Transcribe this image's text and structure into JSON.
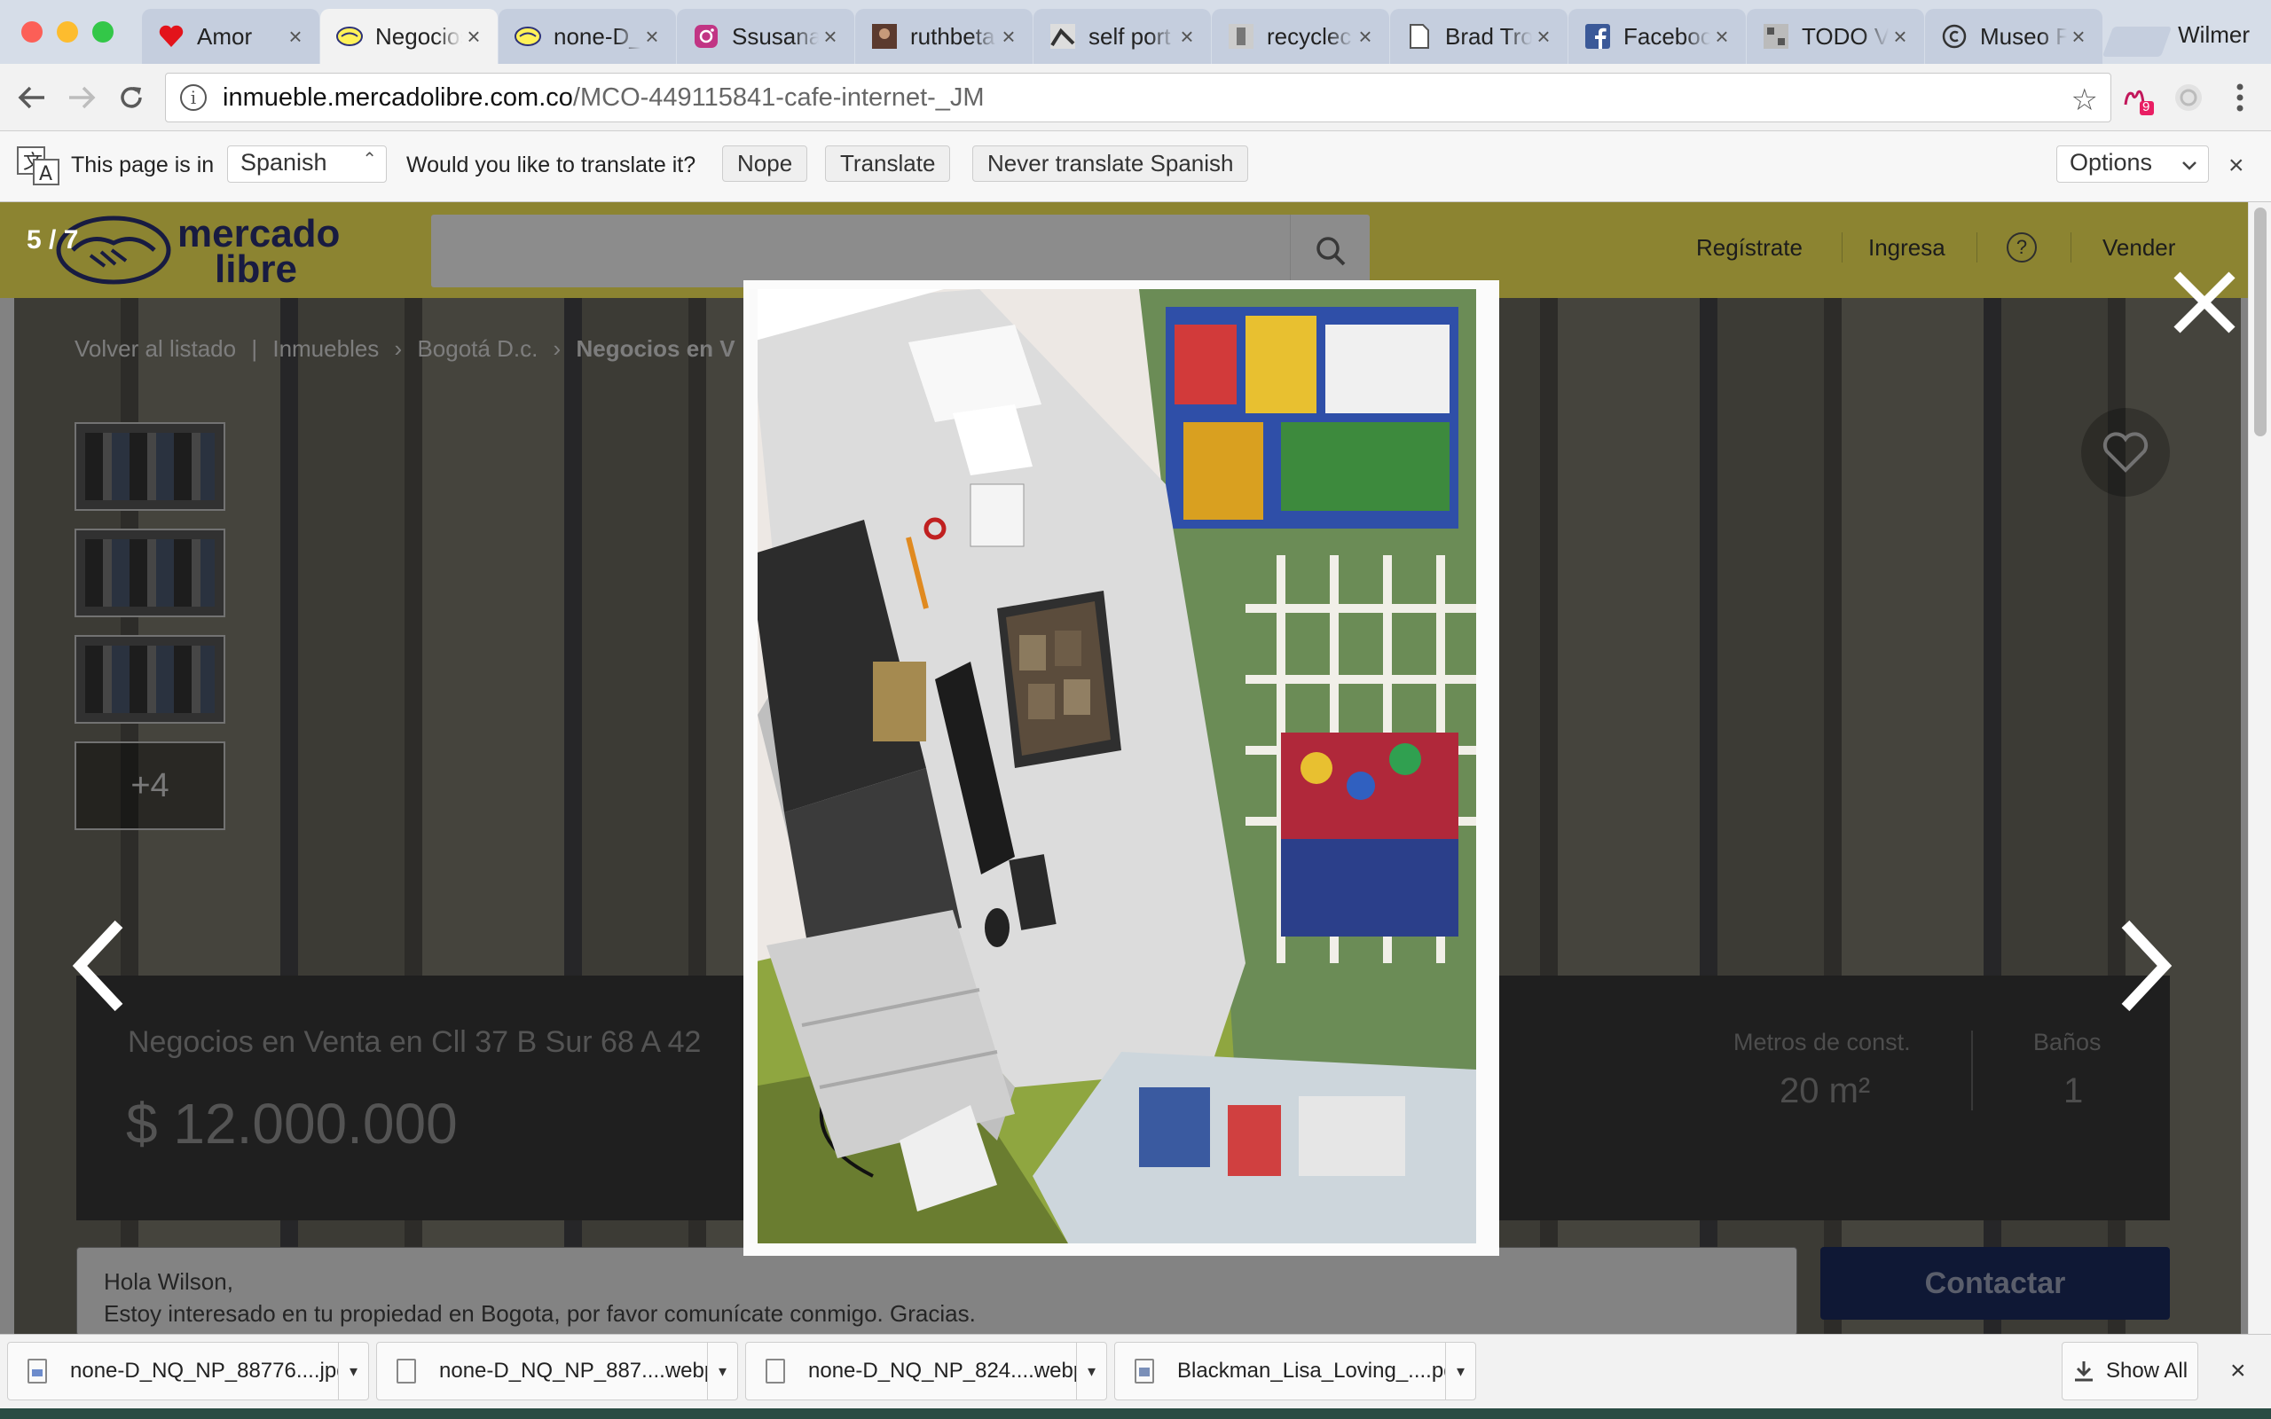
{
  "browser": {
    "tabs": [
      {
        "title": "Amor",
        "icon": "heart-icon",
        "active": false
      },
      {
        "title": "Negocios",
        "icon": "mercadolibre-icon",
        "active": true
      },
      {
        "title": "none-D_",
        "icon": "mercadolibre-icon",
        "active": false
      },
      {
        "title": "Ssusana",
        "icon": "instagram-icon",
        "active": false
      },
      {
        "title": "ruthbeta",
        "icon": "photo-icon",
        "active": false
      },
      {
        "title": "self port",
        "icon": "image-icon",
        "active": false
      },
      {
        "title": "recyclec",
        "icon": "image-icon",
        "active": false
      },
      {
        "title": "Brad Tro",
        "icon": "document-icon",
        "active": false
      },
      {
        "title": "Faceboo",
        "icon": "facebook-icon",
        "active": false
      },
      {
        "title": "TODO V",
        "icon": "image-icon",
        "active": false
      },
      {
        "title": "Museo F",
        "icon": "copyright-icon",
        "active": false
      }
    ],
    "profile_name": "Wilmer",
    "url_host": "inmueble.mercadolibre.com.co",
    "url_path": "/MCO-449115841-cafe-internet-_JM",
    "extension_badge": "9"
  },
  "translate_bar": {
    "page_is_in": "This page is in",
    "language": "Spanish",
    "question": "Would you like to translate it?",
    "nope": "Nope",
    "translate": "Translate",
    "never": "Never translate Spanish",
    "options": "Options",
    "close": "×"
  },
  "site": {
    "logo_line1": "mercado",
    "logo_line2": "libre",
    "nav": [
      "Regístrate",
      "Ingresa",
      "?",
      "Vender"
    ]
  },
  "breadcrumb": {
    "back": "Volver al listado",
    "sep": "|",
    "items": [
      "Inmuebles",
      "Bogotá D.c.",
      "Negocios en V"
    ],
    "arrow": "›"
  },
  "gallery": {
    "counter": "5 / 7",
    "more_label": "+4"
  },
  "listing": {
    "title": "Negocios en Venta en Cll 37 B Sur 68 A 42",
    "price": "$ 12.000.000",
    "stats": [
      {
        "label": "Metros de const.",
        "value": "20 m²"
      },
      {
        "label": "Baños",
        "value": "1"
      }
    ]
  },
  "contact": {
    "message_line1": "Hola Wilson,",
    "message_line2": "Estoy interesado en tu propiedad en Bogota, por favor comunícate conmigo. Gracias.",
    "button": "Contactar"
  },
  "downloads": {
    "items": [
      {
        "name": "none-D_NQ_NP_88776....jpg",
        "icon": "image-file-icon"
      },
      {
        "name": "none-D_NQ_NP_887....webp",
        "icon": "file-icon"
      },
      {
        "name": "none-D_NQ_NP_824....webp",
        "icon": "file-icon"
      },
      {
        "name": "Blackman_Lisa_Loving_....pdf",
        "icon": "pdf-file-icon"
      }
    ],
    "show_all": "Show All",
    "close": "×"
  },
  "colors": {
    "ml_yellow": "#fff159",
    "ml_blue": "#2d3277",
    "contact_button": "#1c2c62"
  }
}
